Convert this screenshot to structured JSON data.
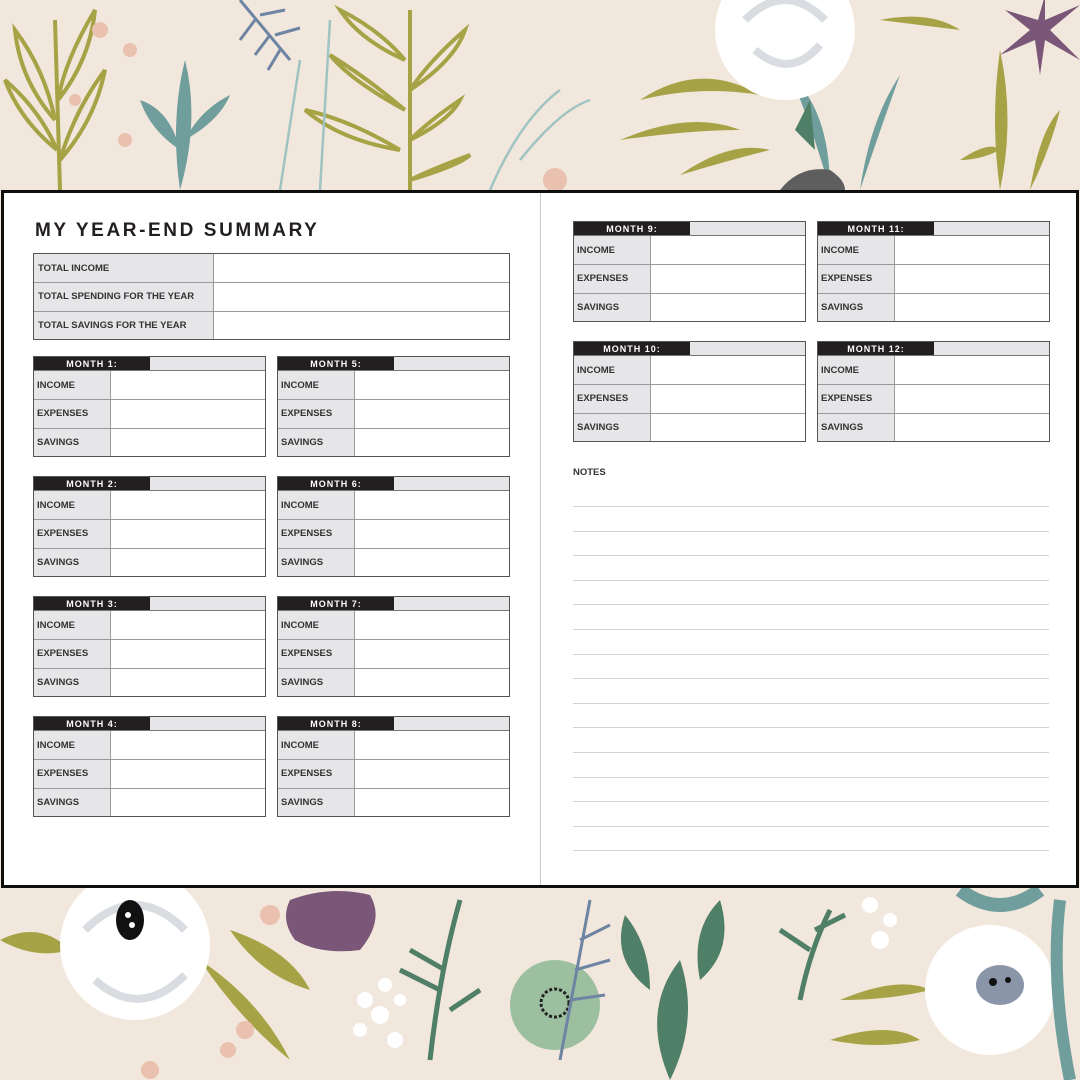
{
  "title": "MY YEAR-END SUMMARY",
  "summary": {
    "rows": [
      {
        "label": "TOTAL INCOME",
        "value": ""
      },
      {
        "label": "TOTAL SPENDING FOR THE YEAR",
        "value": ""
      },
      {
        "label": "TOTAL SAVINGS FOR THE YEAR",
        "value": ""
      }
    ]
  },
  "months": [
    {
      "label": "MONTH 1:",
      "value": "",
      "rows": [
        {
          "label": "INCOME",
          "value": ""
        },
        {
          "label": "EXPENSES",
          "value": ""
        },
        {
          "label": "SAVINGS",
          "value": ""
        }
      ]
    },
    {
      "label": "MONTH 2:",
      "value": "",
      "rows": [
        {
          "label": "INCOME",
          "value": ""
        },
        {
          "label": "EXPENSES",
          "value": ""
        },
        {
          "label": "SAVINGS",
          "value": ""
        }
      ]
    },
    {
      "label": "MONTH 3:",
      "value": "",
      "rows": [
        {
          "label": "INCOME",
          "value": ""
        },
        {
          "label": "EXPENSES",
          "value": ""
        },
        {
          "label": "SAVINGS",
          "value": ""
        }
      ]
    },
    {
      "label": "MONTH 4:",
      "value": "",
      "rows": [
        {
          "label": "INCOME",
          "value": ""
        },
        {
          "label": "EXPENSES",
          "value": ""
        },
        {
          "label": "SAVINGS",
          "value": ""
        }
      ]
    },
    {
      "label": "MONTH 5:",
      "value": "",
      "rows": [
        {
          "label": "INCOME",
          "value": ""
        },
        {
          "label": "EXPENSES",
          "value": ""
        },
        {
          "label": "SAVINGS",
          "value": ""
        }
      ]
    },
    {
      "label": "MONTH 6:",
      "value": "",
      "rows": [
        {
          "label": "INCOME",
          "value": ""
        },
        {
          "label": "EXPENSES",
          "value": ""
        },
        {
          "label": "SAVINGS",
          "value": ""
        }
      ]
    },
    {
      "label": "MONTH 7:",
      "value": "",
      "rows": [
        {
          "label": "INCOME",
          "value": ""
        },
        {
          "label": "EXPENSES",
          "value": ""
        },
        {
          "label": "SAVINGS",
          "value": ""
        }
      ]
    },
    {
      "label": "MONTH 8:",
      "value": "",
      "rows": [
        {
          "label": "INCOME",
          "value": ""
        },
        {
          "label": "EXPENSES",
          "value": ""
        },
        {
          "label": "SAVINGS",
          "value": ""
        }
      ]
    },
    {
      "label": "MONTH 9:",
      "value": "",
      "rows": [
        {
          "label": "INCOME",
          "value": ""
        },
        {
          "label": "EXPENSES",
          "value": ""
        },
        {
          "label": "SAVINGS",
          "value": ""
        }
      ]
    },
    {
      "label": "MONTH 10:",
      "value": "",
      "rows": [
        {
          "label": "INCOME",
          "value": ""
        },
        {
          "label": "EXPENSES",
          "value": ""
        },
        {
          "label": "SAVINGS",
          "value": ""
        }
      ]
    },
    {
      "label": "MONTH 11:",
      "value": "",
      "rows": [
        {
          "label": "INCOME",
          "value": ""
        },
        {
          "label": "EXPENSES",
          "value": ""
        },
        {
          "label": "SAVINGS",
          "value": ""
        }
      ]
    },
    {
      "label": "MONTH 12:",
      "value": "",
      "rows": [
        {
          "label": "INCOME",
          "value": ""
        },
        {
          "label": "EXPENSES",
          "value": ""
        },
        {
          "label": "SAVINGS",
          "value": ""
        }
      ]
    }
  ],
  "notes": {
    "label": "NOTES",
    "line_count": 15
  },
  "colors": {
    "background": "#f2e7dc",
    "header_band": "#231f20",
    "label_cell": "#e6e6e8",
    "olive": "#a6a346",
    "teal": "#6f9e9c",
    "sage": "#9cbf9f",
    "plum": "#7a5778",
    "blush": "#eac0ae",
    "forest": "#4f7f66",
    "slate_blue": "#6e84a3"
  }
}
